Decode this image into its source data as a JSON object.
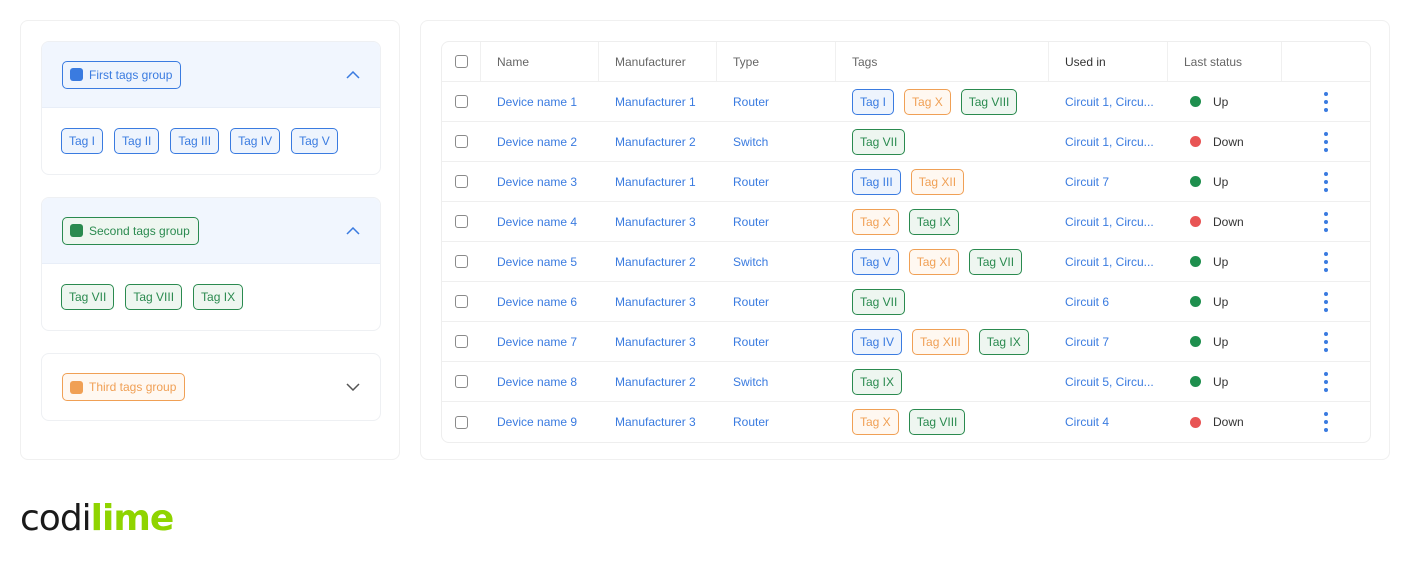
{
  "colors": {
    "blue": "#3a7be0",
    "green": "#2a8a4f",
    "orange": "#f0a055",
    "status_up": "#1e8f4e",
    "status_down": "#e85454"
  },
  "tag_groups": [
    {
      "label": "First tags group",
      "color": "blue",
      "expanded": true,
      "chevron": "chevron-up-icon",
      "tags": [
        "Tag I",
        "Tag II",
        "Tag III",
        "Tag IV",
        "Tag V"
      ]
    },
    {
      "label": "Second tags group",
      "color": "green",
      "expanded": true,
      "chevron": "chevron-up-icon",
      "tags": [
        "Tag VII",
        "Tag VIII",
        "Tag IX"
      ]
    },
    {
      "label": "Third tags group",
      "color": "orange",
      "expanded": false,
      "chevron": "chevron-down-icon",
      "tags": []
    }
  ],
  "table": {
    "columns": [
      "Name",
      "Manufacturer",
      "Type",
      "Tags",
      "Used in",
      "Last status"
    ],
    "rows": [
      {
        "name": "Device name 1",
        "manufacturer": "Manufacturer 1",
        "type": "Router",
        "tags": [
          {
            "label": "Tag I",
            "color": "blue"
          },
          {
            "label": "Tag X",
            "color": "orange"
          },
          {
            "label": "Tag VIII",
            "color": "green"
          }
        ],
        "used_in": "Circuit 1, Circu...",
        "status": "Up"
      },
      {
        "name": "Device name 2",
        "manufacturer": "Manufacturer 2",
        "type": "Switch",
        "tags": [
          {
            "label": "Tag VII",
            "color": "green"
          }
        ],
        "used_in": "Circuit 1, Circu...",
        "status": "Down"
      },
      {
        "name": "Device name 3",
        "manufacturer": "Manufacturer 1",
        "type": "Router",
        "tags": [
          {
            "label": "Tag III",
            "color": "blue"
          },
          {
            "label": "Tag XII",
            "color": "orange"
          }
        ],
        "used_in": "Circuit 7",
        "status": "Up"
      },
      {
        "name": "Device name 4",
        "manufacturer": "Manufacturer 3",
        "type": "Router",
        "tags": [
          {
            "label": "Tag X",
            "color": "orange"
          },
          {
            "label": "Tag IX",
            "color": "green"
          }
        ],
        "used_in": "Circuit 1, Circu...",
        "status": "Down"
      },
      {
        "name": "Device name 5",
        "manufacturer": "Manufacturer 2",
        "type": "Switch",
        "tags": [
          {
            "label": "Tag V",
            "color": "blue"
          },
          {
            "label": "Tag XI",
            "color": "orange"
          },
          {
            "label": "Tag VII",
            "color": "green"
          }
        ],
        "used_in": "Circuit 1, Circu...",
        "status": "Up"
      },
      {
        "name": "Device name 6",
        "manufacturer": "Manufacturer 3",
        "type": "Router",
        "tags": [
          {
            "label": "Tag VII",
            "color": "green"
          }
        ],
        "used_in": "Circuit 6",
        "status": "Up"
      },
      {
        "name": "Device name 7",
        "manufacturer": "Manufacturer 3",
        "type": "Router",
        "tags": [
          {
            "label": "Tag IV",
            "color": "blue"
          },
          {
            "label": "Tag XIII",
            "color": "orange"
          },
          {
            "label": "Tag IX",
            "color": "green"
          }
        ],
        "used_in": "Circuit 7",
        "status": "Up"
      },
      {
        "name": "Device name 8",
        "manufacturer": "Manufacturer 2",
        "type": "Switch",
        "tags": [
          {
            "label": "Tag IX",
            "color": "green"
          }
        ],
        "used_in": "Circuit 5, Circu...",
        "status": "Up"
      },
      {
        "name": "Device name 9",
        "manufacturer": "Manufacturer 3",
        "type": "Router",
        "tags": [
          {
            "label": "Tag X",
            "color": "orange"
          },
          {
            "label": "Tag VIII",
            "color": "green"
          }
        ],
        "used_in": "Circuit 4",
        "status": "Down"
      }
    ]
  },
  "logo": {
    "part1": "codi",
    "part2": "lime"
  }
}
